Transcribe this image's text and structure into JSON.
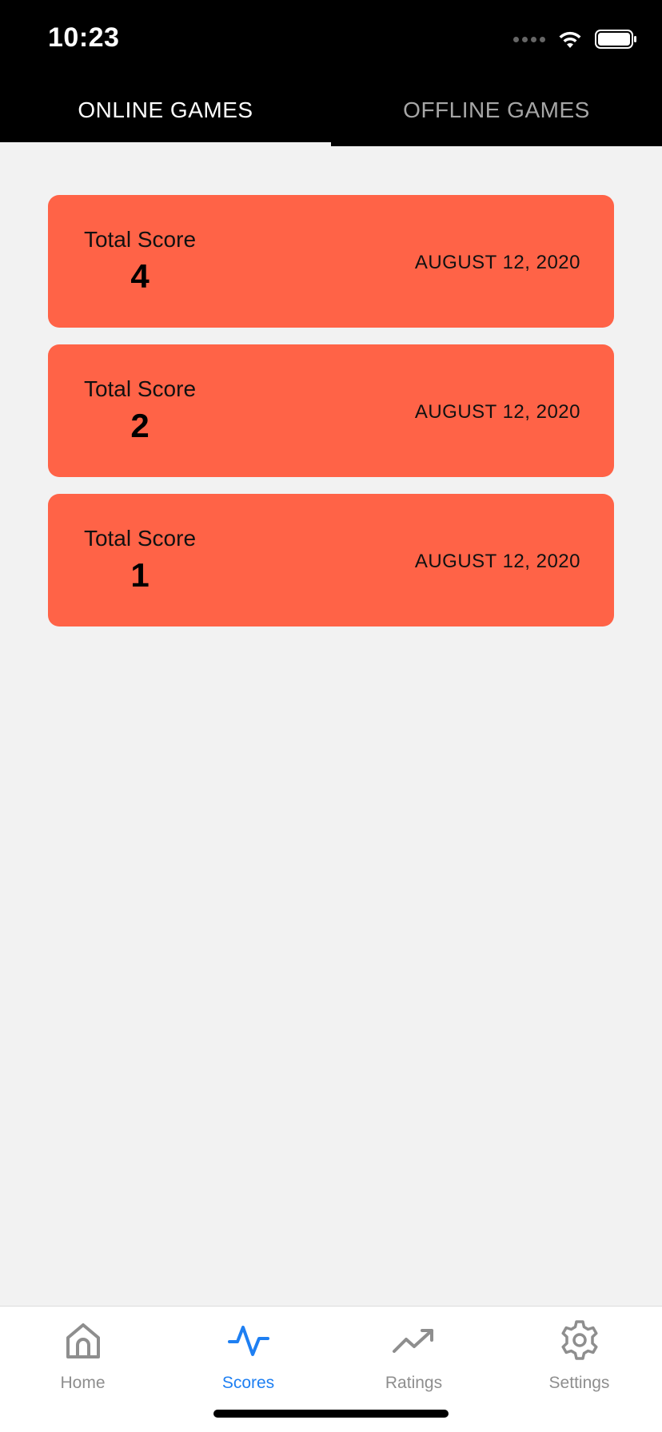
{
  "status_bar": {
    "time": "10:23"
  },
  "top_tabs": [
    {
      "label": "ONLINE GAMES",
      "active": true
    },
    {
      "label": "OFFLINE GAMES",
      "active": false
    }
  ],
  "cards": [
    {
      "label": "Total Score",
      "score": "4",
      "date": "AUGUST 12, 2020"
    },
    {
      "label": "Total Score",
      "score": "2",
      "date": "AUGUST 12, 2020"
    },
    {
      "label": "Total Score",
      "score": "1",
      "date": "AUGUST 12, 2020"
    }
  ],
  "bottom_nav": [
    {
      "label": "Home",
      "icon": "home-icon",
      "active": false
    },
    {
      "label": "Scores",
      "icon": "activity-icon",
      "active": true
    },
    {
      "label": "Ratings",
      "icon": "trending-up-icon",
      "active": false
    },
    {
      "label": "Settings",
      "icon": "gear-icon",
      "active": false
    }
  ],
  "colors": {
    "card": "#ff6347",
    "active_nav": "#1e7ff2",
    "inactive_nav": "#8e8e8e",
    "header": "#000000",
    "background": "#f2f2f2"
  }
}
